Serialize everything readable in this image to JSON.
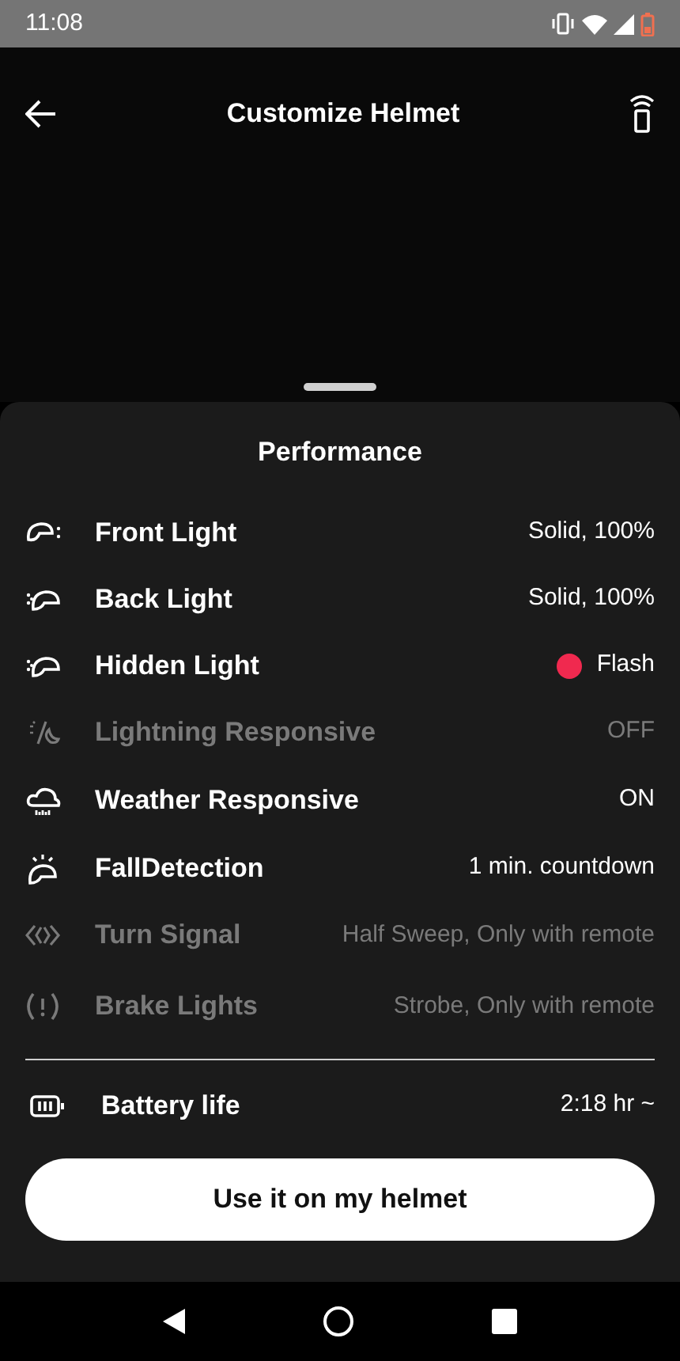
{
  "status_bar": {
    "time": "11:08"
  },
  "app_bar": {
    "title": "Customize Helmet"
  },
  "sheet": {
    "title": "Performance",
    "rows": [
      {
        "kind": "front",
        "label": "Front Light",
        "value": "Solid, 100%",
        "disabled": false
      },
      {
        "kind": "back",
        "label": "Back Light",
        "value": "Solid, 100%",
        "disabled": false
      },
      {
        "kind": "hidden",
        "label": "Hidden Light",
        "value": "Flash",
        "disabled": false,
        "color": "#f0294f"
      },
      {
        "kind": "lightning",
        "label": "Lightning Responsive",
        "value": "OFF",
        "disabled": true
      },
      {
        "kind": "weather",
        "label": "Weather Responsive",
        "value": "ON",
        "disabled": false
      },
      {
        "kind": "fall",
        "label": "FallDetection",
        "value": "1 min. countdown",
        "disabled": false
      },
      {
        "kind": "turn",
        "label": "Turn Signal",
        "value": "Half Sweep, Only with remote",
        "disabled": true
      },
      {
        "kind": "brake",
        "label": "Brake Lights",
        "value": "Strobe, Only with remote",
        "disabled": true
      }
    ],
    "battery": {
      "label": "Battery life",
      "value": "2:18 hr ~"
    },
    "button": "Use it on my helmet"
  }
}
